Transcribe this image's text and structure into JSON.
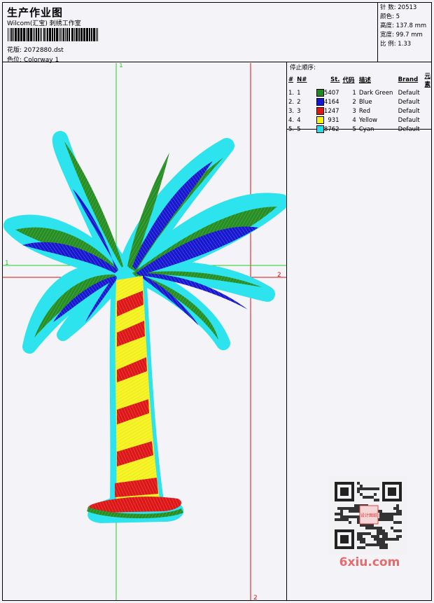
{
  "header": {
    "title": "生产作业图",
    "company": "Wilcom(汇宝) 刺绣工作室",
    "pattern_label": "花版:",
    "pattern_value": "2072880.dst",
    "colorway_label": "色位:",
    "colorway_value": "Colorway 1"
  },
  "stats": {
    "stitches": "针 数: 20513",
    "colors": "颜色: 5",
    "height": "高度: 137.8 mm",
    "width": "宽度: 99.7 mm",
    "scale": "比 例: 1.33"
  },
  "stop_sequence": {
    "title": "停止顺序:",
    "columns": [
      "#",
      "N#",
      "St.",
      "代码",
      "描述",
      "Brand",
      "元素"
    ],
    "rows": [
      {
        "num": "1.",
        "n": "1",
        "color": "#1e8a1e",
        "stitches": "5407",
        "code": "1",
        "desc": "Dark Green",
        "brand": "Default"
      },
      {
        "num": "2.",
        "n": "2",
        "color": "#1515d8",
        "stitches": "4164",
        "code": "2",
        "desc": "Blue",
        "brand": "Default"
      },
      {
        "num": "3.",
        "n": "3",
        "color": "#e21515",
        "stitches": "1247",
        "code": "3",
        "desc": "Red",
        "brand": "Default"
      },
      {
        "num": "4.",
        "n": "4",
        "color": "#f5f20c",
        "stitches": "931",
        "code": "4",
        "desc": "Yellow",
        "brand": "Default"
      },
      {
        "num": "5.",
        "n": "5",
        "color": "#1ee0ea",
        "stitches": "8762",
        "code": "5",
        "desc": "Cyan",
        "brand": "Default"
      }
    ]
  },
  "guides": {
    "v1": "1",
    "v2": "2",
    "h1": "1",
    "h2": "2"
  },
  "watermark": "6xiu.com",
  "seal_text": "设计图纸"
}
